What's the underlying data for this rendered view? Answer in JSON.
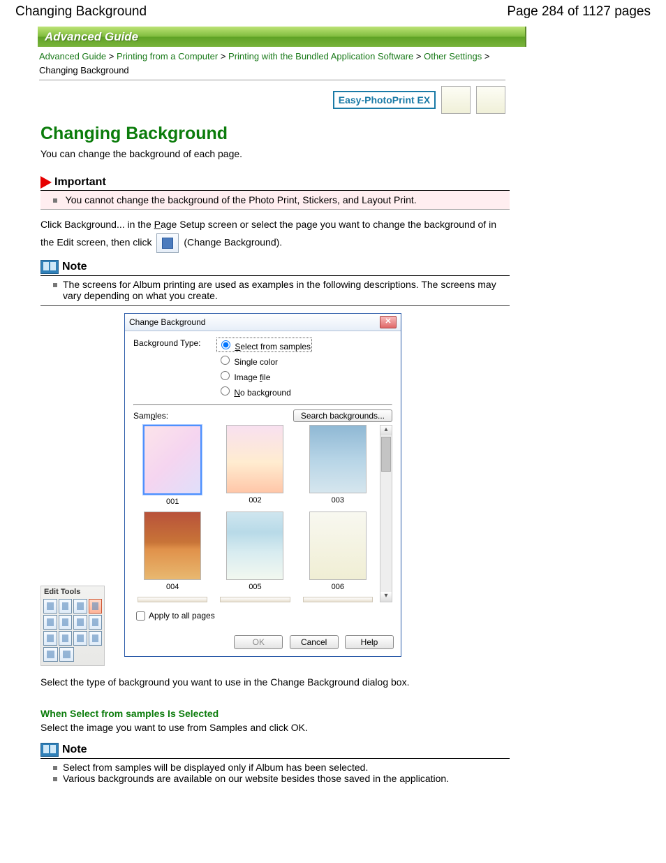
{
  "header": {
    "page_title": "Changing Background",
    "page_indicator": "Page 284 of 1127 pages"
  },
  "banner": "Advanced Guide",
  "breadcrumb": {
    "items": [
      "Advanced Guide",
      "Printing from a Computer",
      "Printing with the Bundled Application Software",
      "Other Settings"
    ],
    "current": "Changing Background"
  },
  "app_badge": "Easy-PhotoPrint EX",
  "title": "Changing Background",
  "intro": "You can change the background of each page.",
  "important": {
    "label": "Important",
    "text": "You cannot change the background of the Photo Print, Stickers, and Layout Print."
  },
  "instruction": {
    "pre": "Click Background... in the ",
    "u1": "P",
    "mid1": "age Setup screen or select the page you want to change the background of in the Edit screen, then click",
    "post": " (Change Background)."
  },
  "note1": {
    "label": "Note",
    "text": "The screens for Album printing are used as examples in the following descriptions. The screens may vary depending on what you create."
  },
  "edit_tools": {
    "title": "Edit Tools"
  },
  "dialog": {
    "title": "Change Background",
    "bg_type_label": "Background Type:",
    "opts": {
      "select_samples": "Select from samples",
      "single_color": "Single color",
      "image_file": "Image file",
      "no_bg": "No background"
    },
    "samples_label": "Samples:",
    "search_btn": "Search backgrounds...",
    "thumbs": [
      "001",
      "002",
      "003",
      "004",
      "005",
      "006"
    ],
    "apply_label": "Apply to all pages",
    "ok": "OK",
    "cancel": "Cancel",
    "help": "Help"
  },
  "after_dialog": "Select the type of background you want to use in the Change Background dialog box.",
  "section2": {
    "heading": "When Select from samples Is Selected",
    "text": "Select the image you want to use from Samples and click OK."
  },
  "note2": {
    "label": "Note",
    "item1": "Select from samples will be displayed only if Album has been selected.",
    "item2": "Various backgrounds are available on our website besides those saved in the application."
  }
}
